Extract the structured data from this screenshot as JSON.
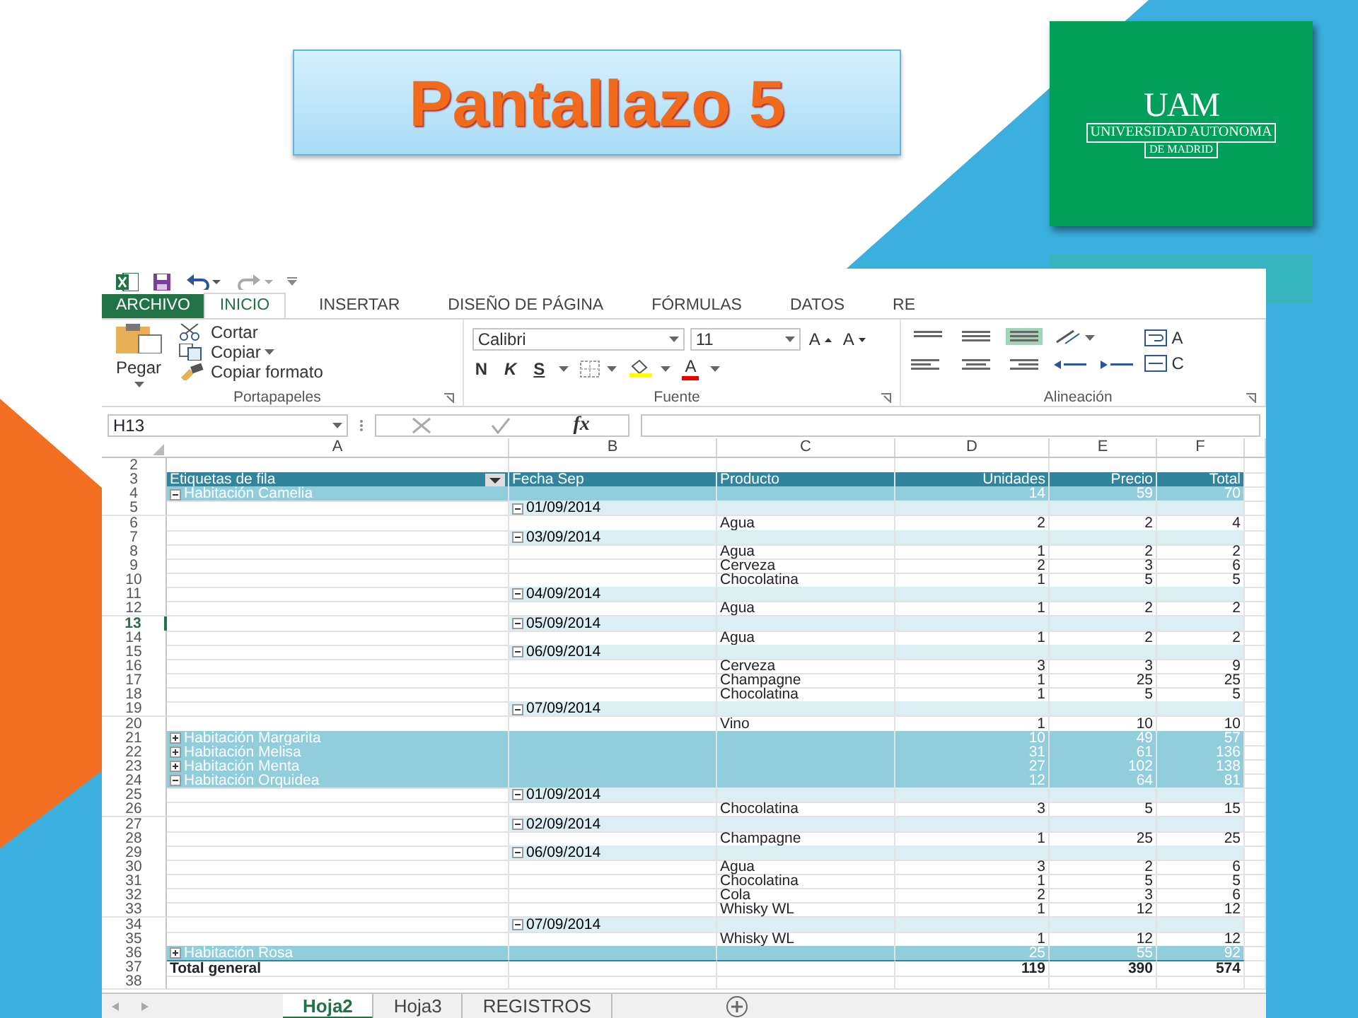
{
  "slide": {
    "title": "Pantallazo 5",
    "logo": {
      "letters": "UAM",
      "name": "UNIVERSIDAD AUTONOMA",
      "city": "DE MADRID"
    }
  },
  "excel": {
    "tabs": [
      {
        "label": "ARCHIVO",
        "kind": "file",
        "selected": false
      },
      {
        "label": "INICIO",
        "kind": "tab",
        "selected": true
      },
      {
        "label": "INSERTAR",
        "kind": "tab",
        "selected": false
      },
      {
        "label": "DISEÑO DE PÁGINA",
        "kind": "tab",
        "selected": false
      },
      {
        "label": "FÓRMULAS",
        "kind": "tab",
        "selected": false
      },
      {
        "label": "DATOS",
        "kind": "tab",
        "selected": false
      },
      {
        "label": "RE",
        "kind": "tab",
        "selected": false
      }
    ],
    "clipboard": {
      "paste": "Pegar",
      "cut": "Cortar",
      "copy": "Copiar",
      "format": "Copiar formato",
      "group": "Portapapeles"
    },
    "font": {
      "family": "Calibri",
      "size": "11",
      "grow": "A",
      "shrink": "A",
      "bold": "N",
      "italic": "K",
      "underline": "S",
      "color_letter": "A",
      "group": "Fuente"
    },
    "alignment": {
      "group": "Alineación",
      "wrap": "A",
      "merge": "C"
    },
    "name_box": "H13",
    "fx": "fx",
    "columns": [
      "A",
      "B",
      "C",
      "D",
      "E",
      "F"
    ],
    "rows": [
      {
        "num": "2",
        "kind": "blank",
        "selected": false
      },
      {
        "num": "3",
        "kind": "header",
        "selected": false,
        "labels": [
          "Etiquetas de fila",
          "Fecha Sep",
          "Producto",
          "Unidades",
          "Precio",
          "Total"
        ]
      },
      {
        "num": "4",
        "kind": "group",
        "selected": false,
        "expanded": true,
        "label": "Habitación Camelia",
        "values": [
          "14",
          "59",
          "70"
        ]
      },
      {
        "num": "5",
        "kind": "date",
        "selected": false,
        "expanded": true,
        "label": "01/09/2014"
      },
      {
        "num": "6",
        "kind": "item",
        "selected": false,
        "label": "Agua",
        "values": [
          "2",
          "2",
          "4"
        ]
      },
      {
        "num": "7",
        "kind": "date",
        "selected": false,
        "expanded": true,
        "label": "03/09/2014"
      },
      {
        "num": "8",
        "kind": "item",
        "selected": false,
        "label": "Agua",
        "values": [
          "1",
          "2",
          "2"
        ]
      },
      {
        "num": "9",
        "kind": "item",
        "selected": false,
        "label": "Cerveza",
        "values": [
          "2",
          "3",
          "6"
        ]
      },
      {
        "num": "10",
        "kind": "item",
        "selected": false,
        "label": "Chocolatina",
        "values": [
          "1",
          "5",
          "5"
        ]
      },
      {
        "num": "11",
        "kind": "date",
        "selected": false,
        "expanded": true,
        "label": "04/09/2014"
      },
      {
        "num": "12",
        "kind": "item",
        "selected": false,
        "label": "Agua",
        "values": [
          "1",
          "2",
          "2"
        ]
      },
      {
        "num": "13",
        "kind": "date",
        "selected": true,
        "expanded": true,
        "label": "05/09/2014"
      },
      {
        "num": "14",
        "kind": "item",
        "selected": false,
        "label": "Agua",
        "values": [
          "1",
          "2",
          "2"
        ]
      },
      {
        "num": "15",
        "kind": "date",
        "selected": false,
        "expanded": true,
        "label": "06/09/2014"
      },
      {
        "num": "16",
        "kind": "item",
        "selected": false,
        "label": "Cerveza",
        "values": [
          "3",
          "3",
          "9"
        ]
      },
      {
        "num": "17",
        "kind": "item",
        "selected": false,
        "label": "Champagne",
        "values": [
          "1",
          "25",
          "25"
        ]
      },
      {
        "num": "18",
        "kind": "item",
        "selected": false,
        "label": "Chocolatina",
        "values": [
          "1",
          "5",
          "5"
        ]
      },
      {
        "num": "19",
        "kind": "date",
        "selected": false,
        "expanded": true,
        "label": "07/09/2014"
      },
      {
        "num": "20",
        "kind": "item",
        "selected": false,
        "label": "Vino",
        "values": [
          "1",
          "10",
          "10"
        ]
      },
      {
        "num": "21",
        "kind": "group",
        "selected": false,
        "expanded": false,
        "label": "Habitación Margarita",
        "values": [
          "10",
          "49",
          "57"
        ]
      },
      {
        "num": "22",
        "kind": "group",
        "selected": false,
        "expanded": false,
        "label": "Habitación Melisa",
        "values": [
          "31",
          "61",
          "136"
        ]
      },
      {
        "num": "23",
        "kind": "group",
        "selected": false,
        "expanded": false,
        "label": "Habitación Menta",
        "values": [
          "27",
          "102",
          "138"
        ]
      },
      {
        "num": "24",
        "kind": "group",
        "selected": false,
        "expanded": true,
        "label": "Habitación Orquidea",
        "values": [
          "12",
          "64",
          "81"
        ]
      },
      {
        "num": "25",
        "kind": "date",
        "selected": false,
        "expanded": true,
        "label": "01/09/2014"
      },
      {
        "num": "26",
        "kind": "item",
        "selected": false,
        "label": "Chocolatina",
        "values": [
          "3",
          "5",
          "15"
        ]
      },
      {
        "num": "27",
        "kind": "date",
        "selected": false,
        "expanded": true,
        "label": "02/09/2014"
      },
      {
        "num": "28",
        "kind": "item",
        "selected": false,
        "label": "Champagne",
        "values": [
          "1",
          "25",
          "25"
        ]
      },
      {
        "num": "29",
        "kind": "date",
        "selected": false,
        "expanded": true,
        "label": "06/09/2014"
      },
      {
        "num": "30",
        "kind": "item",
        "selected": false,
        "label": "Agua",
        "values": [
          "3",
          "2",
          "6"
        ]
      },
      {
        "num": "31",
        "kind": "item",
        "selected": false,
        "label": "Chocolatina",
        "values": [
          "1",
          "5",
          "5"
        ]
      },
      {
        "num": "32",
        "kind": "item",
        "selected": false,
        "label": "Cola",
        "values": [
          "2",
          "3",
          "6"
        ]
      },
      {
        "num": "33",
        "kind": "item",
        "selected": false,
        "label": "Whisky WL",
        "values": [
          "1",
          "12",
          "12"
        ]
      },
      {
        "num": "34",
        "kind": "date",
        "selected": false,
        "expanded": true,
        "label": "07/09/2014"
      },
      {
        "num": "35",
        "kind": "item",
        "selected": false,
        "label": "Whisky WL",
        "values": [
          "1",
          "12",
          "12"
        ]
      },
      {
        "num": "36",
        "kind": "group",
        "selected": false,
        "expanded": false,
        "label": "Habitación Rosa",
        "values": [
          "25",
          "55",
          "92"
        ]
      },
      {
        "num": "37",
        "kind": "total",
        "selected": false,
        "label": "Total general",
        "values": [
          "119",
          "390",
          "574"
        ]
      },
      {
        "num": "38",
        "kind": "blank",
        "selected": false
      }
    ],
    "sheets": [
      {
        "label": "Hoja2",
        "selected": true
      },
      {
        "label": "Hoja3",
        "selected": false
      },
      {
        "label": "REGISTROS",
        "selected": false
      }
    ]
  }
}
